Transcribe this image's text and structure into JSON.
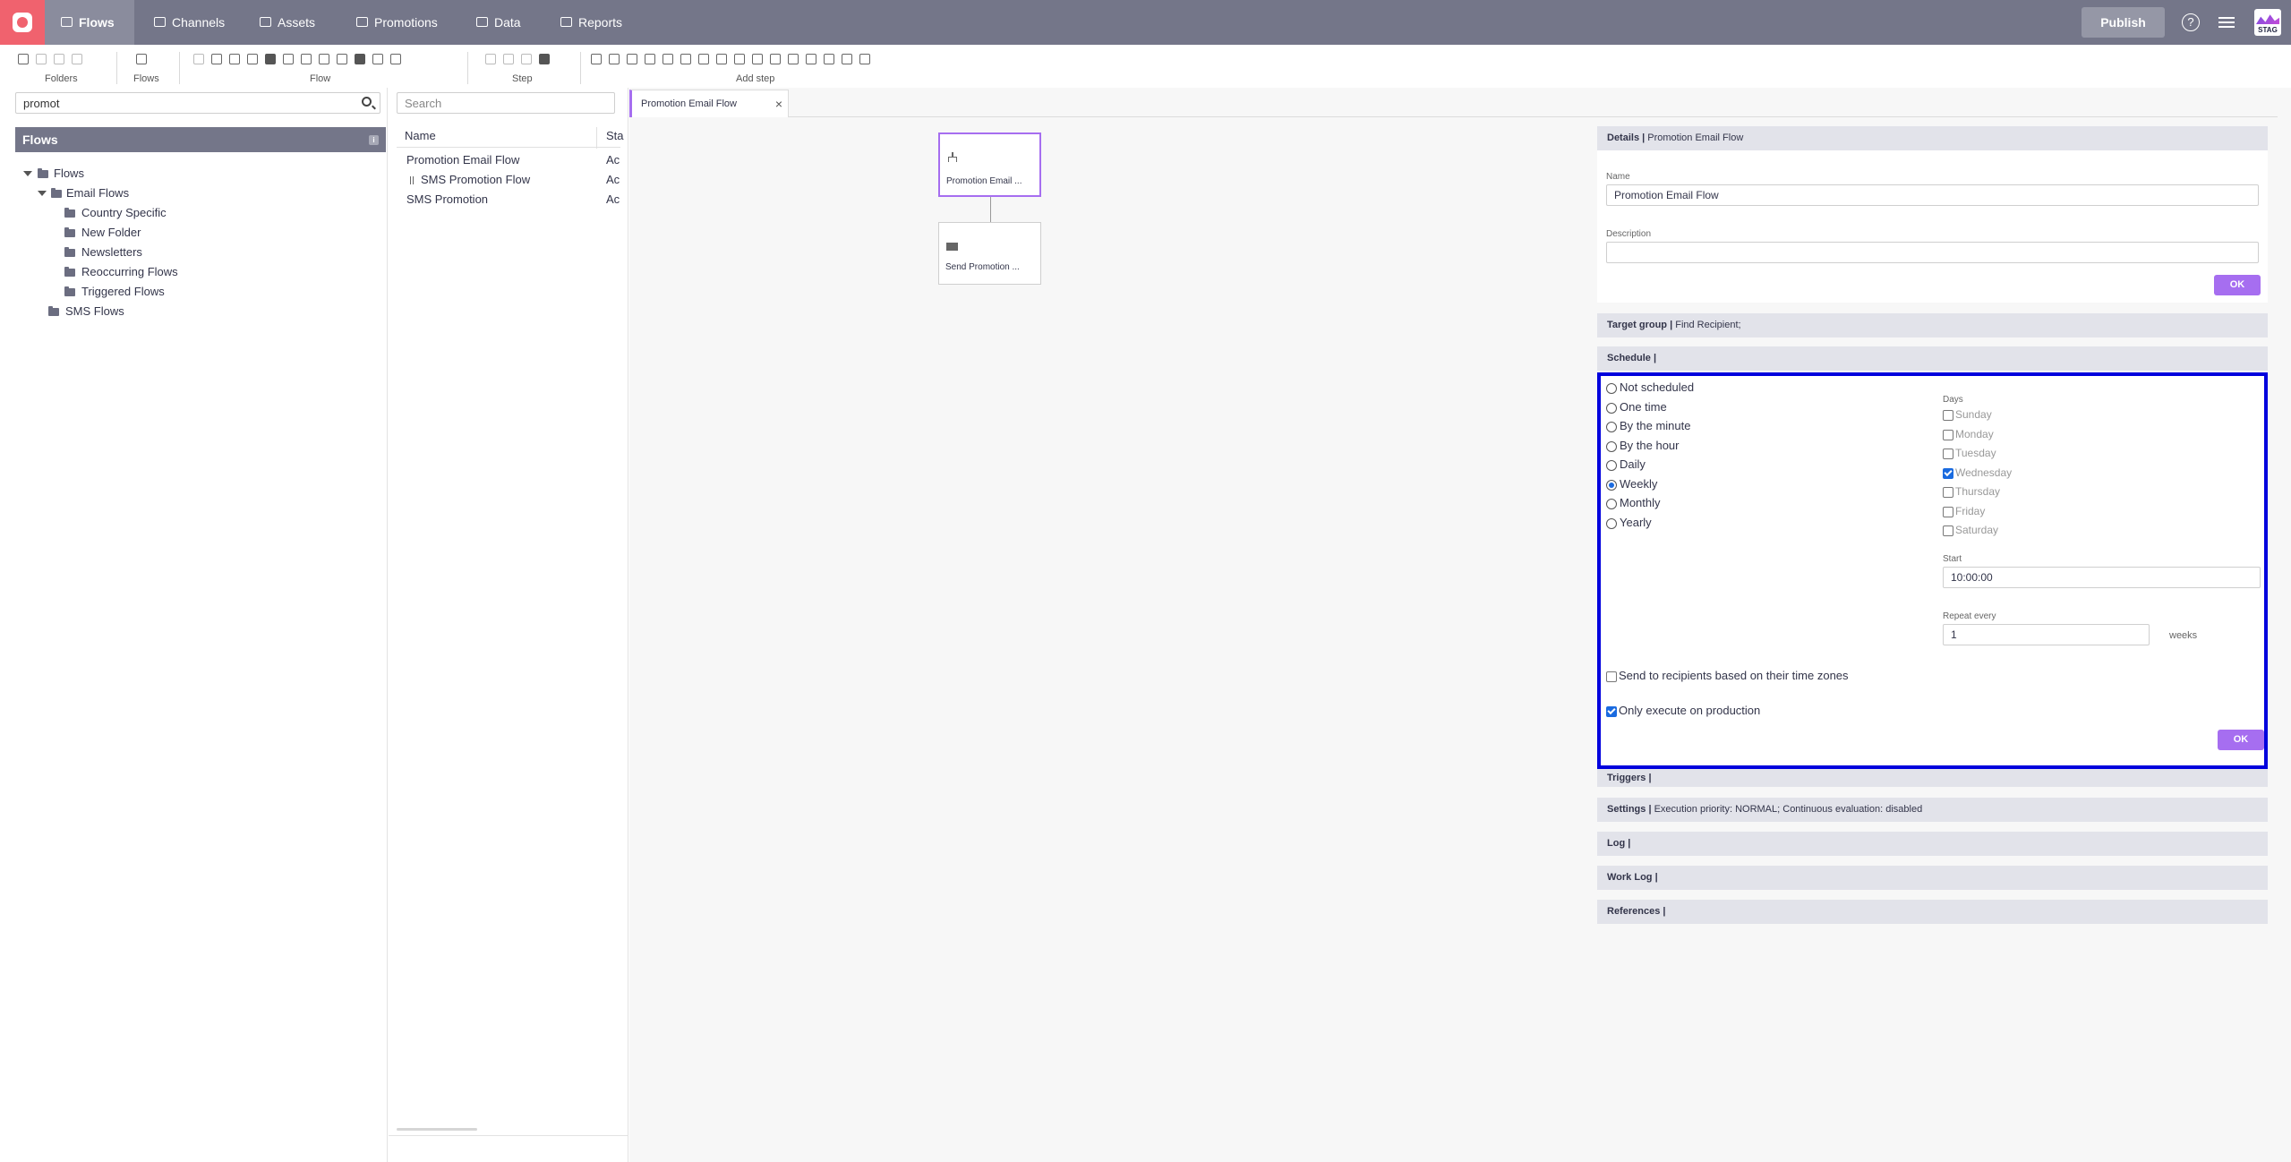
{
  "nav": {
    "items": [
      {
        "label": "Flows",
        "icon": "flows-icon"
      },
      {
        "label": "Channels",
        "icon": "channels-icon"
      },
      {
        "label": "Assets",
        "icon": "assets-icon"
      },
      {
        "label": "Promotions",
        "icon": "promotions-icon"
      },
      {
        "label": "Data",
        "icon": "data-icon"
      },
      {
        "label": "Reports",
        "icon": "reports-icon"
      }
    ],
    "publish_label": "Publish",
    "help_glyph": "?",
    "avatar_text": "STAG"
  },
  "toolbar": {
    "groups": [
      {
        "label": "Folders"
      },
      {
        "label": "Flows"
      },
      {
        "label": "Flow"
      },
      {
        "label": "Step"
      },
      {
        "label": "Add step"
      }
    ]
  },
  "left": {
    "search_value": "promot",
    "header": "Flows",
    "info_glyph": "i",
    "tree": [
      {
        "label": "Flows"
      },
      {
        "label": "Email Flows"
      },
      {
        "label": "Country Specific"
      },
      {
        "label": "New Folder"
      },
      {
        "label": "Newsletters"
      },
      {
        "label": "Reoccurring Flows"
      },
      {
        "label": "Triggered Flows"
      },
      {
        "label": "SMS Flows"
      }
    ]
  },
  "list": {
    "search_placeholder": "Search",
    "col_name": "Name",
    "col_status": "Sta",
    "rows": [
      {
        "name": "Promotion Email Flow",
        "status": "Ac"
      },
      {
        "name": "SMS Promotion Flow",
        "status": "Ac"
      },
      {
        "name": "SMS Promotion",
        "status": "Ac"
      }
    ]
  },
  "editor": {
    "tab_label": "Promotion Email Flow",
    "tab_close": "×",
    "nodes": [
      {
        "label": "Promotion Email ..."
      },
      {
        "label": "Send Promotion ..."
      }
    ]
  },
  "details": {
    "header_bold": "Details |",
    "header_text": "Promotion Email Flow",
    "name_label": "Name",
    "name_value": "Promotion Email Flow",
    "description_label": "Description",
    "description_value": "",
    "ok_label": "OK"
  },
  "target_group": {
    "header_bold": "Target group |",
    "header_text": "Find Recipient;"
  },
  "schedule": {
    "header_bold": "Schedule |",
    "options": [
      {
        "label": "Not scheduled",
        "selected": false
      },
      {
        "label": "One time",
        "selected": false
      },
      {
        "label": "By the minute",
        "selected": false
      },
      {
        "label": "By the hour",
        "selected": false
      },
      {
        "label": "Daily",
        "selected": false
      },
      {
        "label": "Weekly",
        "selected": true
      },
      {
        "label": "Monthly",
        "selected": false
      },
      {
        "label": "Yearly",
        "selected": false
      }
    ],
    "days_label": "Days",
    "days": [
      {
        "label": "Sunday",
        "checked": false
      },
      {
        "label": "Monday",
        "checked": false
      },
      {
        "label": "Tuesday",
        "checked": false
      },
      {
        "label": "Wednesday",
        "checked": true
      },
      {
        "label": "Thursday",
        "checked": false
      },
      {
        "label": "Friday",
        "checked": false
      },
      {
        "label": "Saturday",
        "checked": false
      }
    ],
    "start_label": "Start",
    "start_value": "10:00:00",
    "repeat_label": "Repeat every",
    "repeat_value": "1",
    "repeat_unit": "weeks",
    "timezone_label": "Send to recipients based on their time zones",
    "timezone_checked": false,
    "production_label": "Only execute on production",
    "production_checked": true,
    "ok_label": "OK"
  },
  "sections": {
    "triggers": {
      "header_bold": "Triggers |",
      "header_text": ""
    },
    "settings": {
      "header_bold": "Settings |",
      "header_text": "Execution priority: NORMAL; Continuous evaluation: disabled"
    },
    "log": {
      "header_bold": "Log |",
      "header_text": ""
    },
    "worklog": {
      "header_bold": "Work Log |",
      "header_text": ""
    },
    "references": {
      "header_bold": "References |",
      "header_text": ""
    }
  },
  "colors": {
    "nav_bg": "#747689",
    "logo": "#f0626e",
    "accent": "#a66ef0",
    "focus_border": "#0000dd",
    "radio_selected": "#1a6be0"
  }
}
